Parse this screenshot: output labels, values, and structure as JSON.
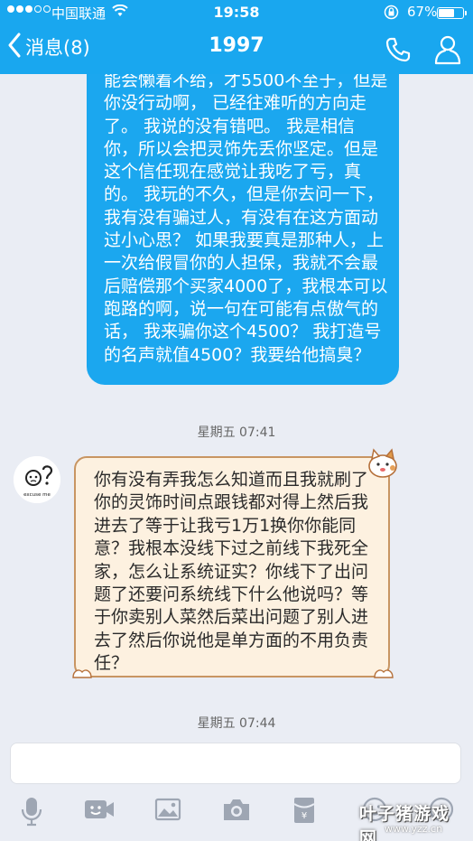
{
  "status_bar": {
    "carrier": "中国联通",
    "time": "19:58",
    "battery": "67%",
    "battery_level": 0.67,
    "signal_bars": 3,
    "signal_total": 5
  },
  "nav": {
    "back_label": "消息(8)",
    "title": "1997"
  },
  "messages": [
    {
      "direction": "out",
      "text": "能会懒着不给，才5500不至于，但是你没行动啊， 已经往难听的方向走了。 我说的没有错吧。 我是相信你，所以会把灵饰先丢你坚定。但是这个信任现在感觉让我吃了亏，真的。 我玩的不久，但是你去问一下，我有没有骗过人，有没有在这方面动过小心思？ 如果我要真是那种人，上一次给假冒你的人担保，我就不会最后赔偿那个买家4000了，我根本可以跑路的啊，说一句在可能有点傲气的话， 我来骗你这个4500？ 我打造号的名声就值4500？我要给他搞臭？"
    },
    {
      "direction": "time",
      "text": "星期五 07:41"
    },
    {
      "direction": "in",
      "text": "你有没有弄我怎么知道而且我就刷了你的灵饰时间点跟钱都对得上然后我进去了等于让我亏1万1换你你能同意？我根本没线下过之前线下我死全家，怎么让系统证实？你线下了出问题了还要问系统线下什么他说吗？等于你卖别人菜然后菜出问题了别人进去了然后你说他是单方面的不用负责任？",
      "avatar_caption": "excuse me"
    },
    {
      "direction": "time",
      "text": "星期五 07:44"
    }
  ],
  "input": {
    "value": ""
  },
  "toolbar": {
    "icons": [
      "microphone-icon",
      "video-icon",
      "image-icon",
      "camera-icon",
      "red-packet-icon",
      "emoji-icon",
      "plus-icon"
    ],
    "red_packet_symbol": "¥"
  },
  "watermark": {
    "title": "叶子猪游戏网",
    "url": "www.yzz.cn"
  },
  "colors": {
    "accent": "#19a7ef",
    "bubble_out": "#1ba7ef",
    "bubble_in": "#fdf1e0",
    "background": "#eaedf4"
  }
}
